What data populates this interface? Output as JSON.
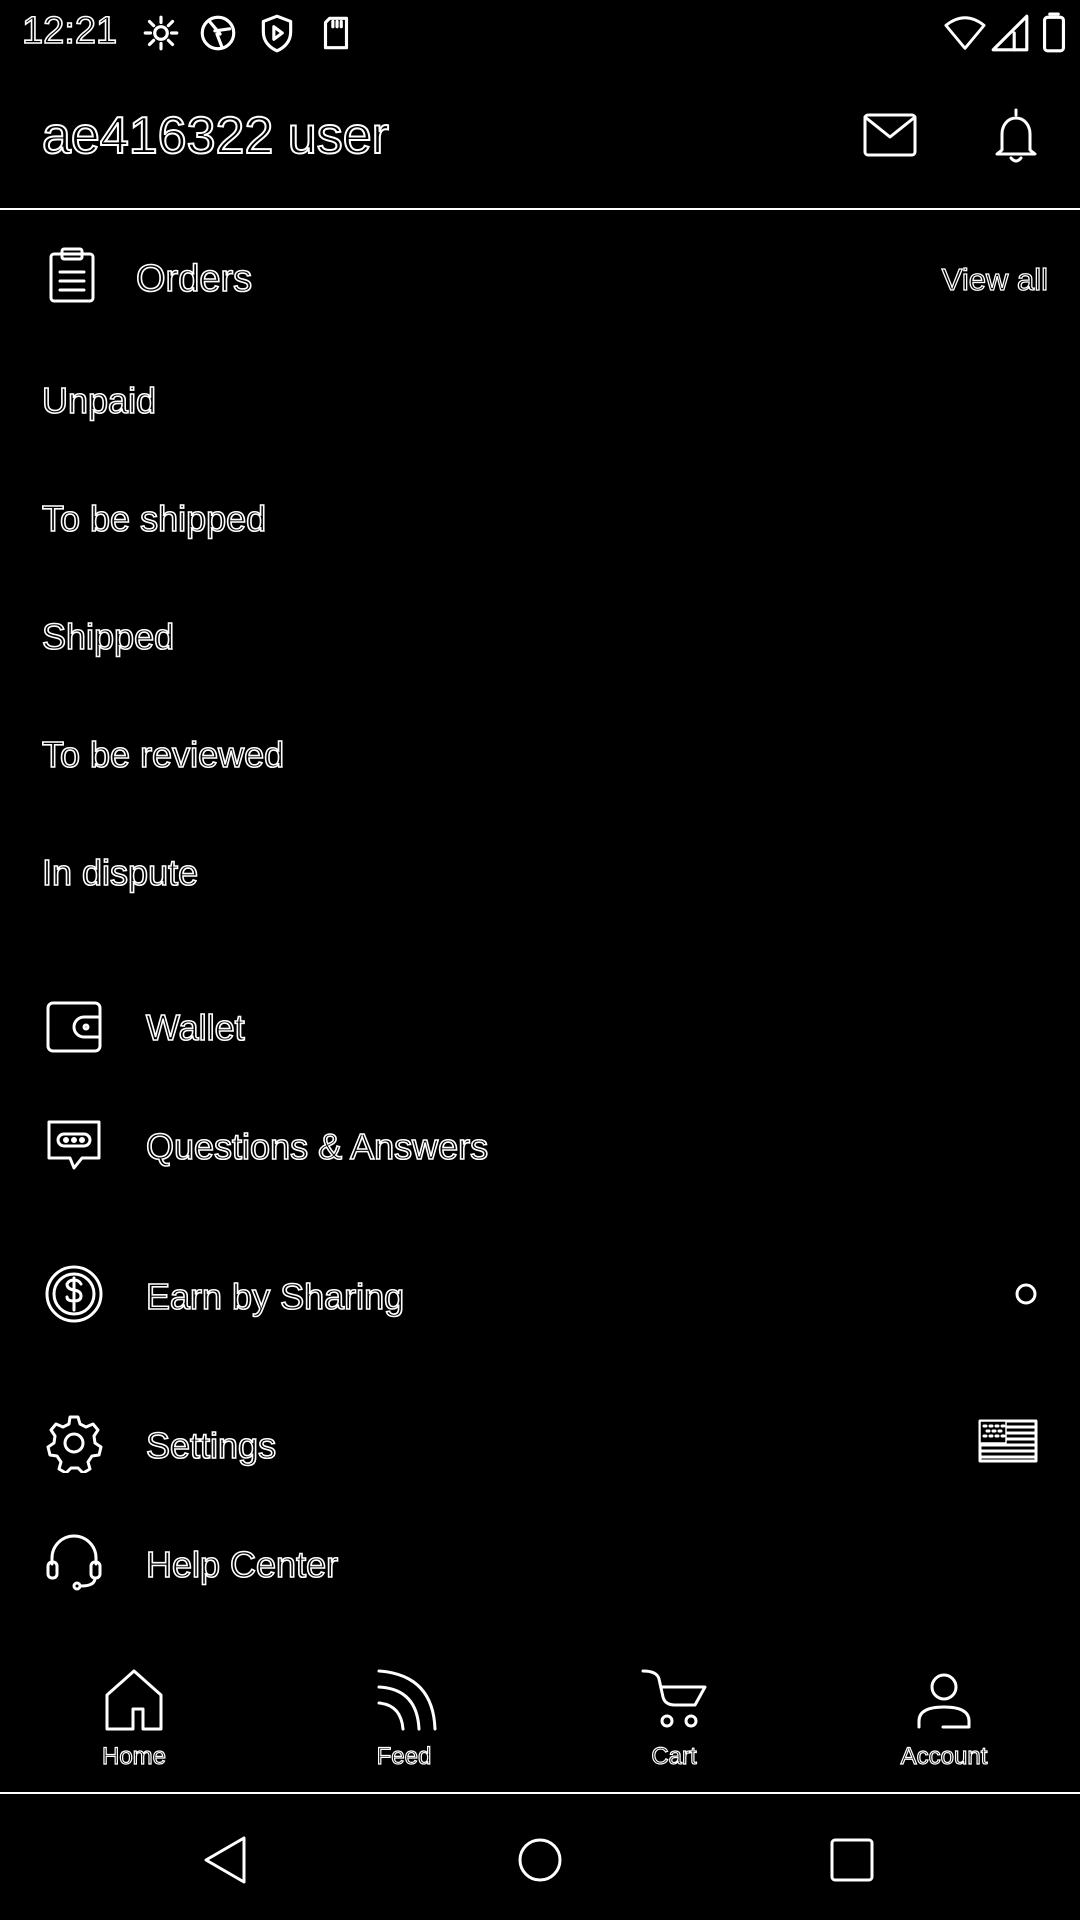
{
  "status_bar": {
    "time": "12:21",
    "left_icons": [
      "gear-icon",
      "shutter-icon",
      "shield-play-icon",
      "sd-card-icon"
    ],
    "right_icons": [
      "wifi-icon",
      "signal-icon",
      "battery-icon"
    ]
  },
  "header": {
    "title": "ae416322 user",
    "icons": [
      "mail-icon",
      "bell-icon"
    ]
  },
  "orders": {
    "title": "Orders",
    "view_all": "View all",
    "items": [
      "Unpaid",
      "To be shipped",
      "Shipped",
      "To be reviewed",
      "In dispute"
    ]
  },
  "menu": [
    {
      "label": "Wallet",
      "icon": "wallet-icon"
    },
    {
      "label": "Questions & Answers",
      "icon": "chat-bubble-icon"
    },
    {
      "label": "Earn by Sharing",
      "icon": "dollar-circle-icon"
    },
    {
      "label": "Settings",
      "icon": "gear-icon"
    },
    {
      "label": "Help Center",
      "icon": "headset-icon"
    }
  ],
  "bottom_nav": [
    {
      "label": "Home",
      "icon": "home-icon"
    },
    {
      "label": "Feed",
      "icon": "feed-icon"
    },
    {
      "label": "Cart",
      "icon": "cart-icon"
    },
    {
      "label": "Account",
      "icon": "account-icon"
    }
  ],
  "system_nav": [
    "back-icon",
    "home-circle-icon",
    "recents-icon"
  ]
}
